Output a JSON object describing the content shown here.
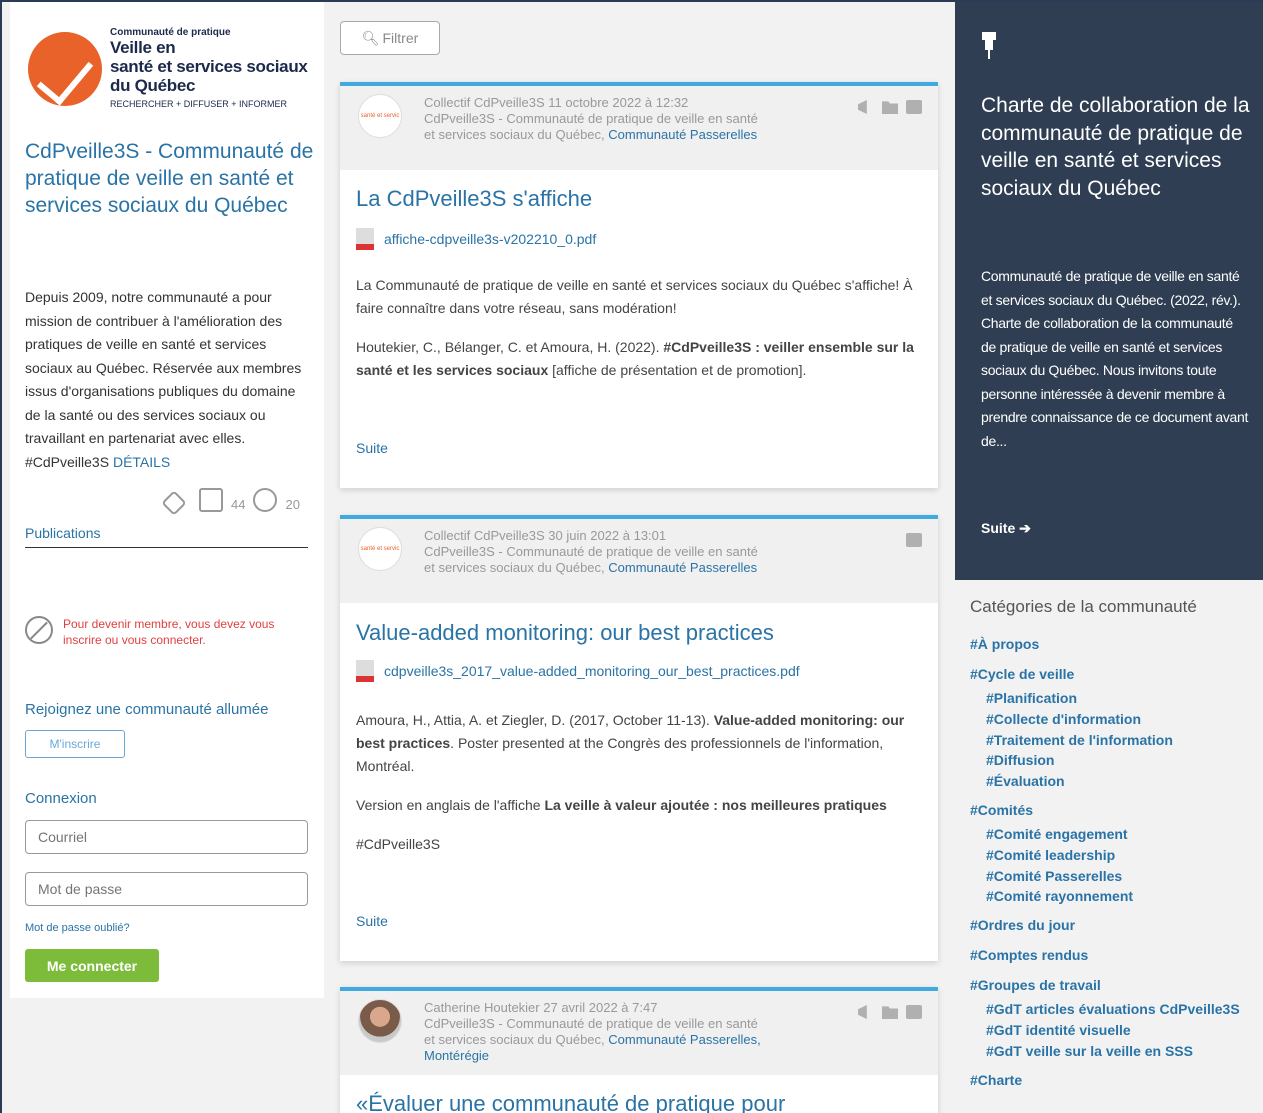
{
  "logo": {
    "small": "Communauté de pratique",
    "line1": "Veille en",
    "line2": "santé et services sociaux",
    "line3": "du Québec",
    "tagline": "RECHERCHER + DIFFUSER + INFORMER"
  },
  "community": {
    "title": "CdPveille3S - Communauté de pratique de veille en santé et services sociaux du Québec",
    "description": "Depuis 2009, notre communauté a pour mission de contribuer à l'amélioration des pratiques de veille en santé et services sociaux au Québec. Réservée aux membres issus d'organisations publiques du domaine de la santé ou des services sociaux ou travaillant en partenariat avec elles. #CdPveille3S",
    "details_link": "DÉTAILS",
    "posts_count": "44",
    "members_count": "20",
    "tab_publications": "Publications"
  },
  "membership": {
    "warning": "Pour devenir membre, vous devez vous inscrire ou vous connecter.",
    "join_title": "Rejoignez une communauté allumée",
    "join_button": "M'inscrire"
  },
  "login": {
    "title": "Connexion",
    "email_placeholder": "Courriel",
    "password_placeholder": "Mot de passe",
    "forgot": "Mot de passe oublié?",
    "submit": "Me connecter"
  },
  "filter": {
    "label": "Filtrer",
    "icon": "search-icon"
  },
  "posts": [
    {
      "author": "Collectif CdPveille3S",
      "date": "11 octobre 2022 à 12:32",
      "groups": "CdPveille3S - Communauté de pratique de veille en santé et services sociaux du Québec,",
      "groups_link": "Communauté Passerelles",
      "avatar_text": "santé et servic",
      "title": "La CdPveille3S s'affiche",
      "file": "affiche-cdpveille3s-v202210_0.pdf",
      "body1": "La Communauté de pratique de veille en santé et services sociaux du Québec s'affiche! À faire connaître dans votre réseau, sans modération!",
      "body2_pre": "Houtekier, C., Bélanger, C. et Amoura, H. (2022).",
      "body2_bold": "#CdPveille3S : veiller ensemble sur la santé et les services sociaux",
      "body2_post": "[affiche de présentation et de promotion].",
      "suite": "Suite"
    },
    {
      "author": "Collectif CdPveille3S",
      "date": "30 juin 2022 à 13:01",
      "groups": "CdPveille3S - Communauté de pratique de veille en santé et services sociaux du Québec,",
      "groups_link": "Communauté Passerelles",
      "avatar_text": "santé et servic",
      "title": "Value-added monitoring: our best practices",
      "file": "cdpveille3s_2017_value-added_monitoring_our_best_practices.pdf",
      "body1_pre": "Amoura, H., Attia, A. et Ziegler, D. (2017, October 11-13).",
      "body1_bold": "Value-added monitoring: our best practices",
      "body1_post": ". Poster presented at the Congrès des professionnels de l'information, Montréal.",
      "body2_pre": "Version en anglais de l'affiche",
      "body2_bold": "La veille à valeur ajoutée : nos meilleures pratiques",
      "body3": "#CdPveille3S",
      "suite": "Suite"
    },
    {
      "author": "Catherine Houtekier",
      "date": "27 avril 2022 à 7:47",
      "groups": "CdPveille3S - Communauté de pratique de veille en santé et services sociaux du Québec,",
      "groups_link": "Communauté Passerelles, Montérégie",
      "title": "«Évaluer une communauté de pratique pour"
    }
  ],
  "pinned": {
    "title": "Charte de collaboration de la communauté de pratique de veille en santé et services sociaux du Québec",
    "description": "Communauté de pratique de veille en santé et services sociaux du Québec. (2022, rév.). Charte de collaboration de la communauté de pratique de veille en santé et services sociaux du Québec. Nous invitons toute personne intéressée à devenir membre à prendre connaissance de ce document avant de...",
    "suite": "Suite ➔"
  },
  "categories": {
    "title": "Catégories de la communauté",
    "apropos": "#À propos",
    "cycle": "#Cycle de veille",
    "cycle_items": [
      "#Planification",
      "#Collecte d'information",
      "#Traitement de l'information",
      "#Diffusion",
      "#Évaluation"
    ],
    "comites": "#Comités",
    "comites_items": [
      "#Comité engagement",
      "#Comité leadership",
      "#Comité Passerelles",
      "#Comité rayonnement"
    ],
    "ordres": "#Ordres du jour",
    "comptes": "#Comptes rendus",
    "groupes": "#Groupes de travail",
    "groupes_items": [
      "#GdT articles évaluations CdPveille3S",
      "#GdT identité visuelle",
      "#GdT veille sur la veille en SSS"
    ],
    "charte": "#Charte"
  },
  "colors": {
    "accent": "#2a73a6",
    "pinned_bg": "#2f3e52",
    "logo_orange": "#e8622a",
    "connect_green": "#7dbb3a",
    "warning_red": "#e04040"
  }
}
